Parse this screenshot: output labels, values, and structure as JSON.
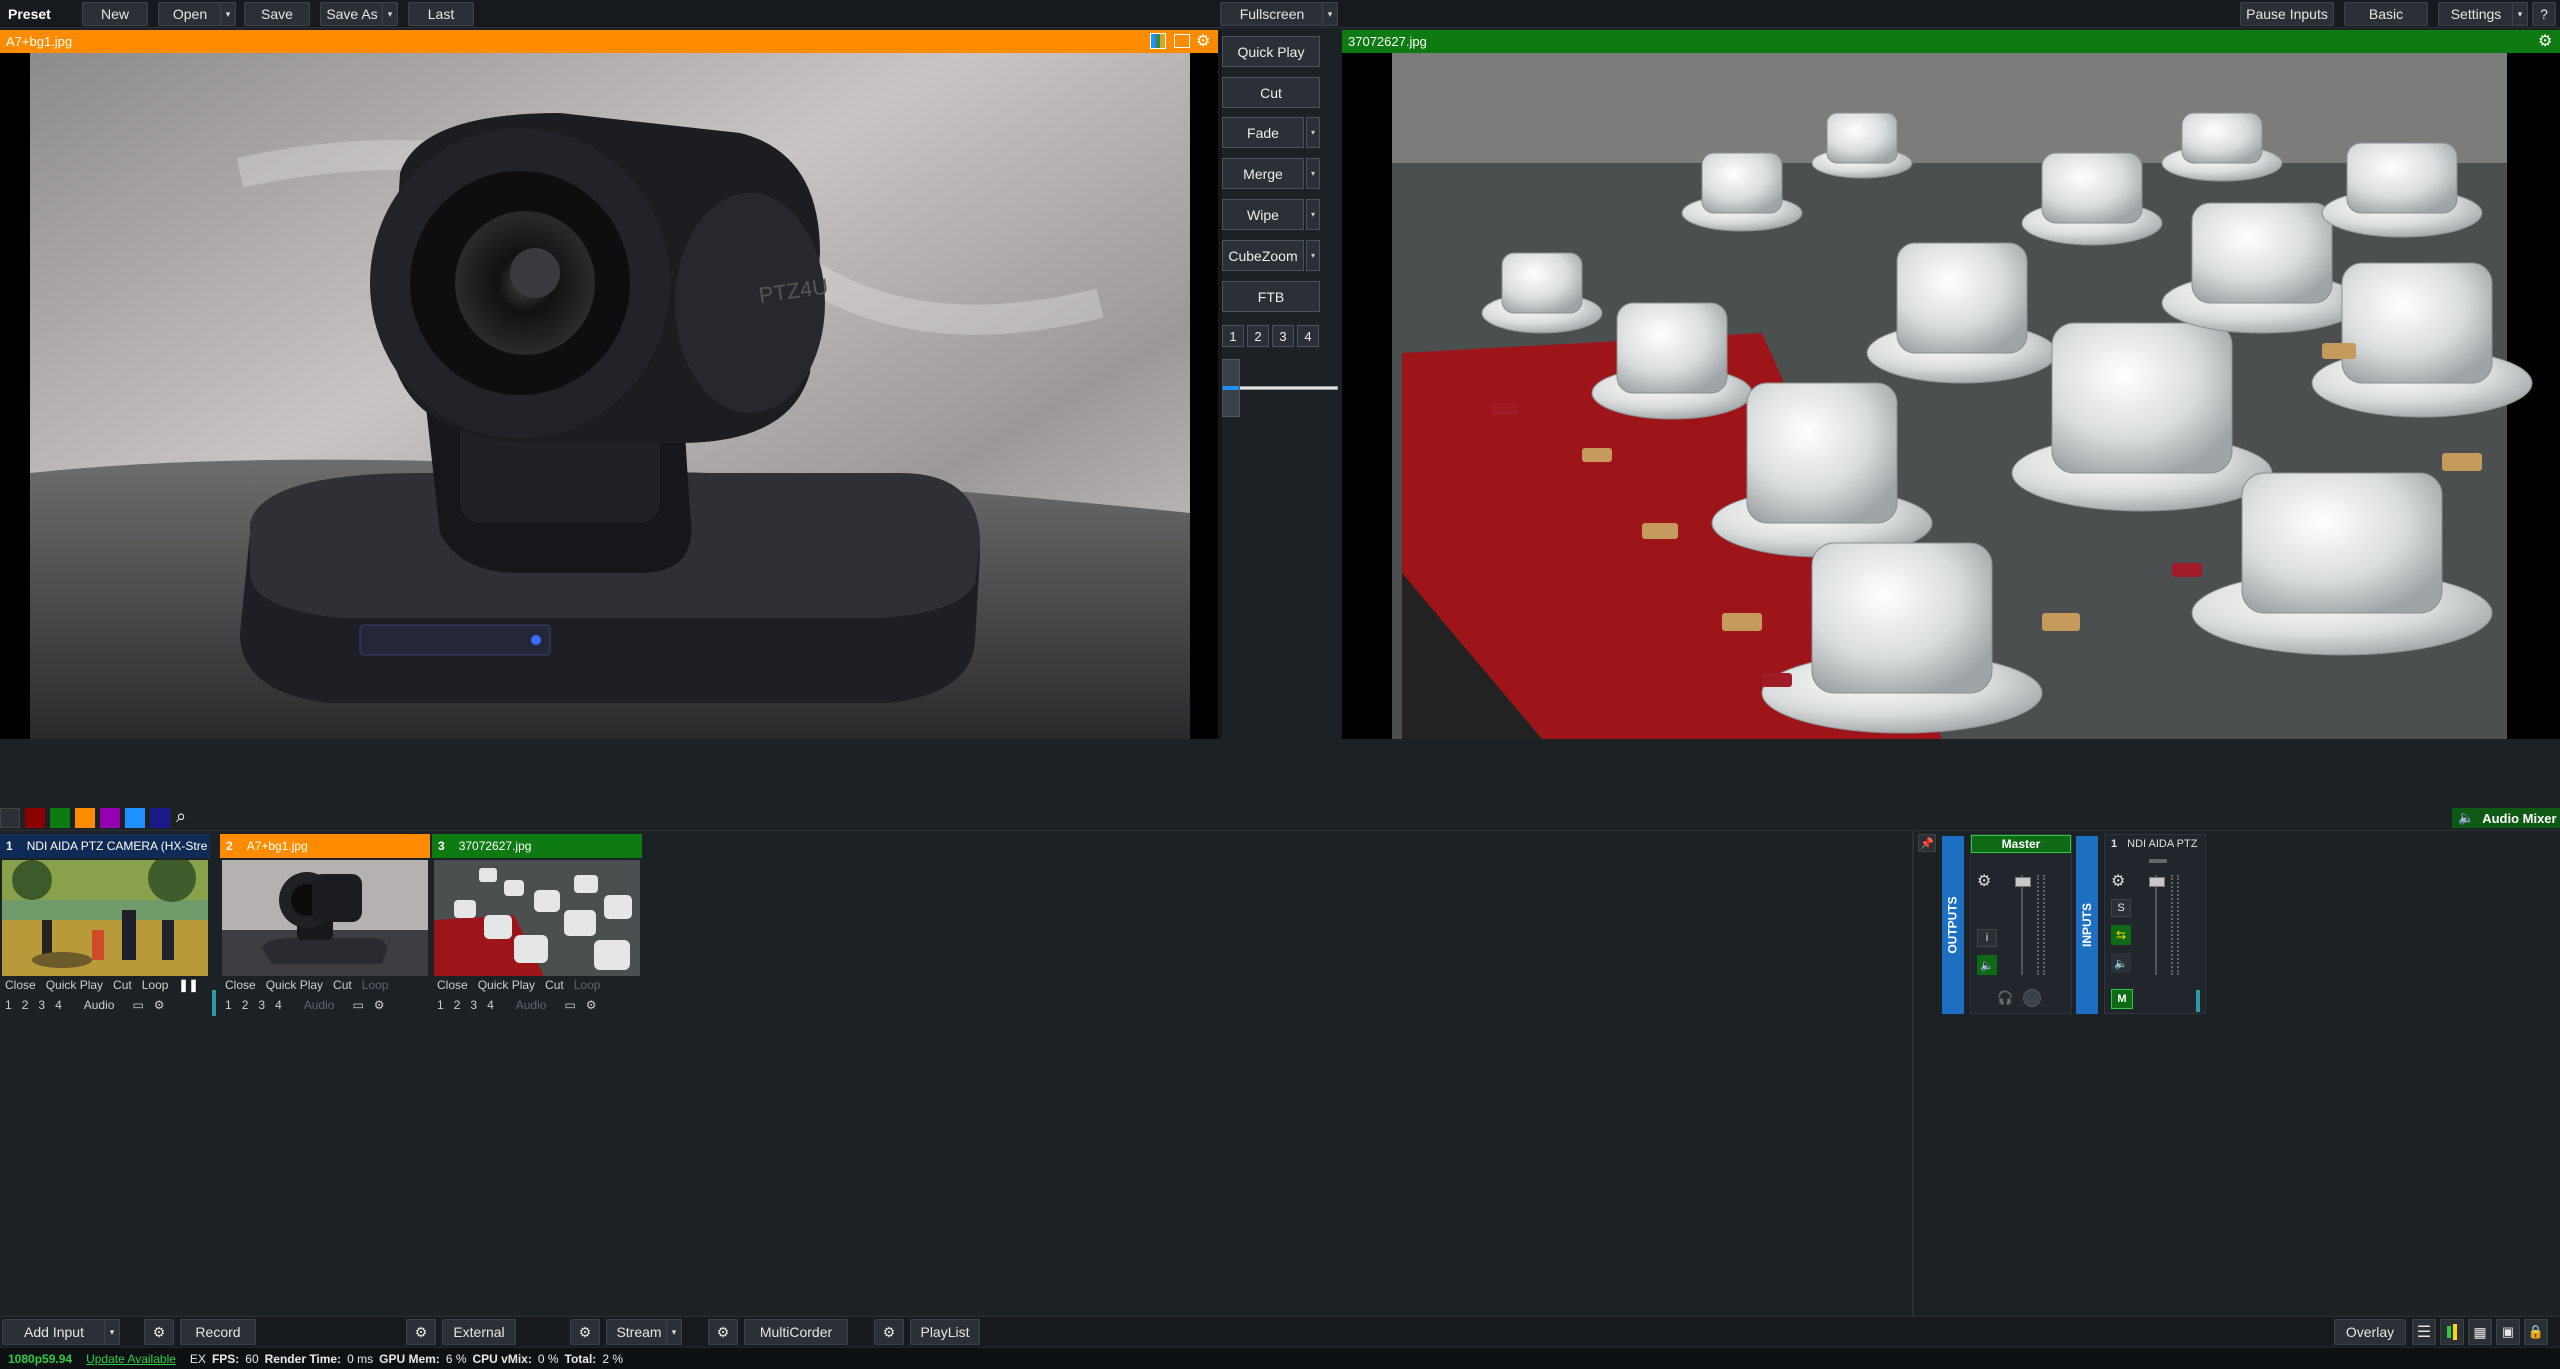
{
  "toolbar": {
    "preset": "Preset",
    "new": "New",
    "open": "Open",
    "save": "Save",
    "save_as": "Save As",
    "last": "Last",
    "fullscreen": "Fullscreen",
    "pause_inputs": "Pause Inputs",
    "basic": "Basic",
    "settings": "Settings",
    "help": "?"
  },
  "preview": {
    "title": "A7+bg1.jpg",
    "color": "#ff8c00"
  },
  "program": {
    "title": "37072627.jpg",
    "color": "#0e7a12"
  },
  "transitions": {
    "quick_play": "Quick Play",
    "cut": "Cut",
    "fade": "Fade",
    "merge": "Merge",
    "wipe": "Wipe",
    "cube_zoom": "CubeZoom",
    "ftb": "FTB",
    "numbers": [
      "1",
      "2",
      "3",
      "4"
    ]
  },
  "color_filters": [
    "#2a3036",
    "#8b0000",
    "#0e7a12",
    "#ff8c00",
    "#9400b0",
    "#1e90ff",
    "#1a1a8a"
  ],
  "audio_mixer_label": "Audio Mixer",
  "inputs": [
    {
      "num": "1",
      "name": "NDI AIDA PTZ CAMERA (HX-Stre",
      "color": "#0f2a55",
      "row1": [
        "Close",
        "Quick Play",
        "Cut",
        "Loop"
      ],
      "row2": [
        "1",
        "2",
        "3",
        "4",
        "Audio"
      ],
      "loop_active": true,
      "audio_active": true
    },
    {
      "num": "2",
      "name": "A7+bg1.jpg",
      "color": "#ff8c00",
      "row1": [
        "Close",
        "Quick Play",
        "Cut",
        "Loop"
      ],
      "row2": [
        "1",
        "2",
        "3",
        "4",
        "Audio"
      ],
      "loop_active": false,
      "audio_active": false
    },
    {
      "num": "3",
      "name": "37072627.jpg",
      "color": "#0e7a12",
      "row1": [
        "Close",
        "Quick Play",
        "Cut",
        "Loop"
      ],
      "row2": [
        "1",
        "2",
        "3",
        "4",
        "Audio"
      ],
      "loop_active": false,
      "audio_active": false
    }
  ],
  "mixer": {
    "outputs_label": "OUTPUTS",
    "inputs_label": "INPUTS",
    "master_label": "Master",
    "channel_num": "1",
    "channel_name": "NDI AIDA PTZ",
    "info_btn": "i",
    "solo_btn": "S",
    "mute_btn": "M"
  },
  "bottom": {
    "add_input": "Add Input",
    "record": "Record",
    "external": "External",
    "stream": "Stream",
    "multicorder": "MultiCorder",
    "playlist": "PlayList",
    "overlay": "Overlay"
  },
  "status": {
    "format": "1080p59.94",
    "update": "Update Available",
    "ex": "EX",
    "fps_label": "FPS:",
    "fps": "60",
    "render_label": "Render Time:",
    "render": "0 ms",
    "gpu_label": "GPU Mem:",
    "gpu": "6 %",
    "cpu_label": "CPU vMix:",
    "cpu": "0 %",
    "total_label": "Total:",
    "total": "2 %"
  }
}
